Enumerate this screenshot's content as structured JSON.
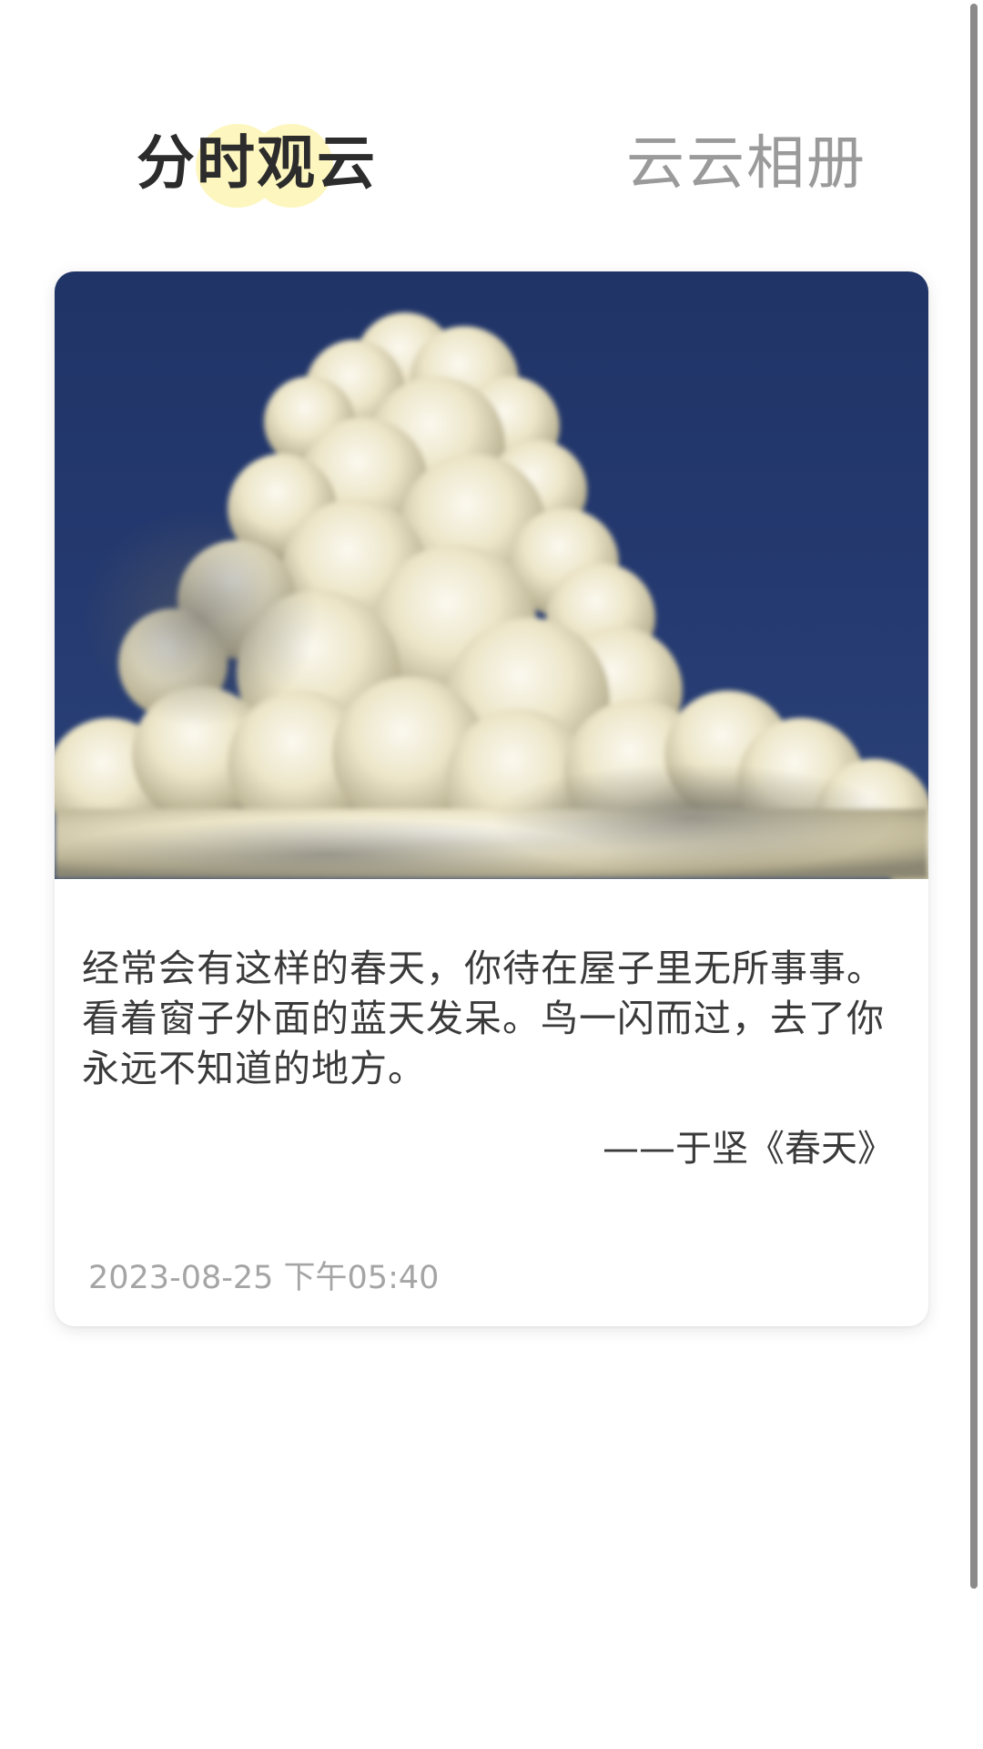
{
  "tabs": {
    "active_label": "分时观云",
    "inactive_label": "云云相册"
  },
  "card": {
    "quote": "经常会有这样的春天，你待在屋子里无所事事。看着窗子外面的蓝天发呆。鸟一闪而过，去了你永远不知道的地方。",
    "source": "——于坚《春天》",
    "timestamp": "2023-08-25 下午05:40"
  },
  "colors": {
    "sky": "#22386d",
    "highlight": "#fdf6bf",
    "active_tab_text": "#2c2c2c",
    "inactive_tab_text": "#9a9a9a",
    "timestamp_text": "#a5a5a5"
  }
}
